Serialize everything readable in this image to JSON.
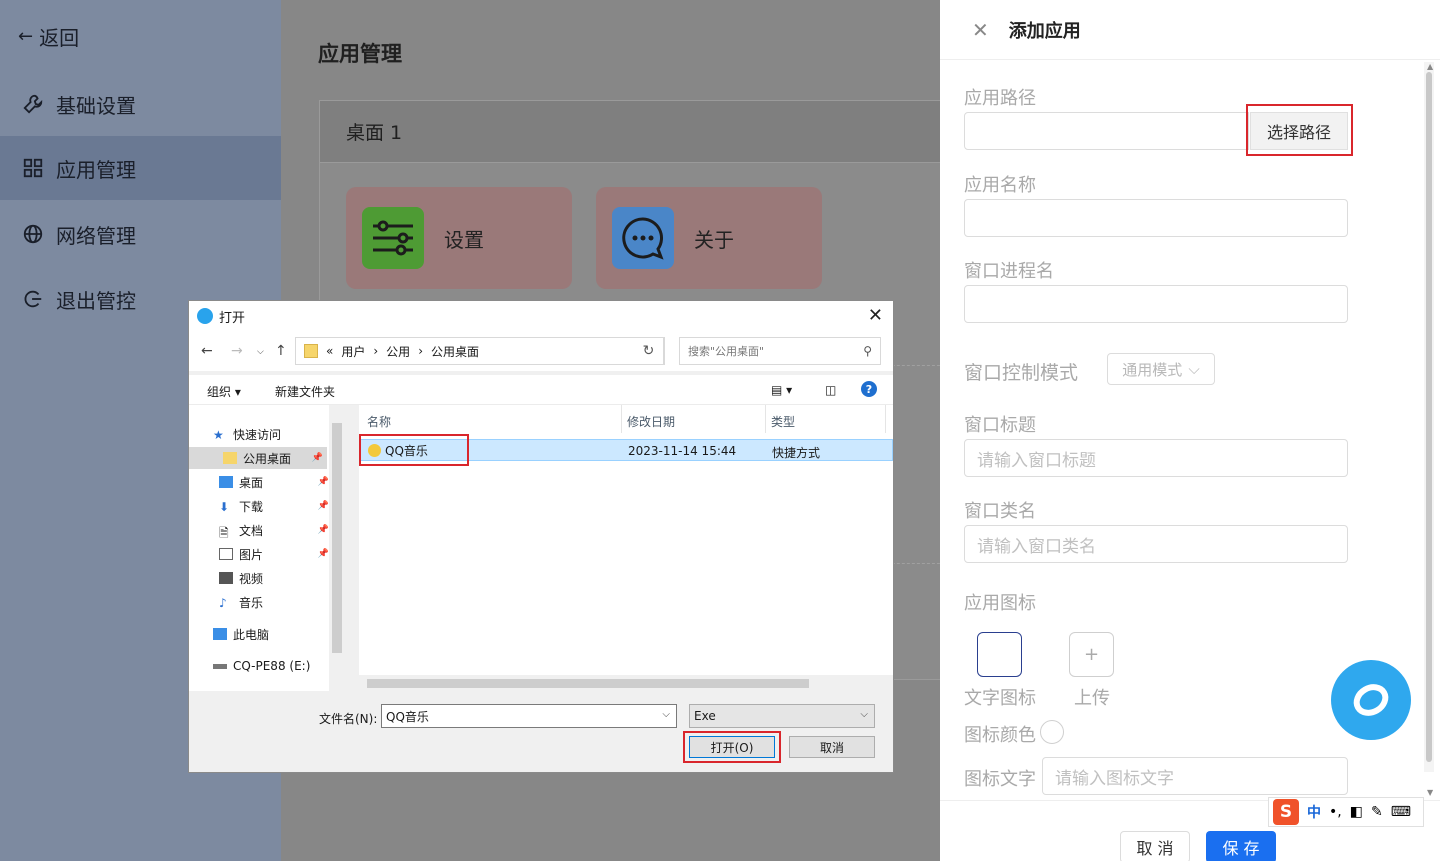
{
  "sidebar": {
    "back_label": "返回",
    "items": [
      {
        "label": "基础设置",
        "icon": "wrench-icon"
      },
      {
        "label": "应用管理",
        "icon": "grid-icon",
        "active": true
      },
      {
        "label": "网络管理",
        "icon": "globe-icon"
      },
      {
        "label": "退出管控",
        "icon": "logout-icon"
      }
    ]
  },
  "main": {
    "title": "应用管理",
    "desktop": {
      "name": "桌面 1",
      "apps": [
        {
          "label": "设置",
          "icon": "sliders-icon",
          "icon_color": "#4e9b34"
        },
        {
          "label": "关于",
          "icon": "chat-icon",
          "icon_color": "#4a86c8"
        }
      ]
    }
  },
  "drawer": {
    "title": "添加应用",
    "path_label": "应用路径",
    "path_value": "",
    "path_button": "选择路径",
    "name_label": "应用名称",
    "name_value": "",
    "process_label": "窗口进程名",
    "process_value": "",
    "mode_label": "窗口控制模式",
    "mode_value": "通用模式",
    "wtitle_label": "窗口标题",
    "wtitle_placeholder": "请输入窗口标题",
    "wclass_label": "窗口类名",
    "wclass_placeholder": "请输入窗口类名",
    "icon_label": "应用图标",
    "text_icon_label": "文字图标",
    "upload_label": "上传",
    "icon_color_label": "图标颜色",
    "icon_text_label": "图标文字",
    "icon_text_placeholder": "请输入图标文字",
    "cancel": "取 消",
    "save": "保 存"
  },
  "ime": {
    "lang": "中",
    "punct": "•,"
  },
  "dialog": {
    "title": "打开",
    "breadcrumb": [
      "«",
      "用户",
      "公用",
      "公用桌面"
    ],
    "search_placeholder": "搜索\"公用桌面\"",
    "organize": "组织 ▾",
    "new_folder": "新建文件夹",
    "tree": [
      {
        "label": "快速访问",
        "icon": "star-icon"
      },
      {
        "label": "公用桌面",
        "icon": "folder-icon",
        "selected": true,
        "pinned": true
      },
      {
        "label": "桌面",
        "icon": "desktop-icon",
        "pinned": true
      },
      {
        "label": "下载",
        "icon": "download-icon",
        "pinned": true
      },
      {
        "label": "文档",
        "icon": "document-icon",
        "pinned": true
      },
      {
        "label": "图片",
        "icon": "picture-icon",
        "pinned": true
      },
      {
        "label": "视频",
        "icon": "video-icon"
      },
      {
        "label": "音乐",
        "icon": "music-icon"
      },
      {
        "label": "此电脑",
        "icon": "computer-icon"
      },
      {
        "label": "CQ-PE88 (E:)",
        "icon": "drive-icon"
      }
    ],
    "columns": [
      "名称",
      "修改日期",
      "类型"
    ],
    "files": [
      {
        "name": "QQ音乐",
        "modified": "2023-11-14 15:44",
        "type": "快捷方式"
      }
    ],
    "filename_label": "文件名(N):",
    "filename_value": "QQ音乐",
    "filetype_value": "Exe",
    "open_button": "打开(O)",
    "cancel_button": "取消"
  },
  "colors": {
    "accent": "#1a6ff0",
    "highlight_box": "#d9262c",
    "selection": "#cce8ff"
  }
}
